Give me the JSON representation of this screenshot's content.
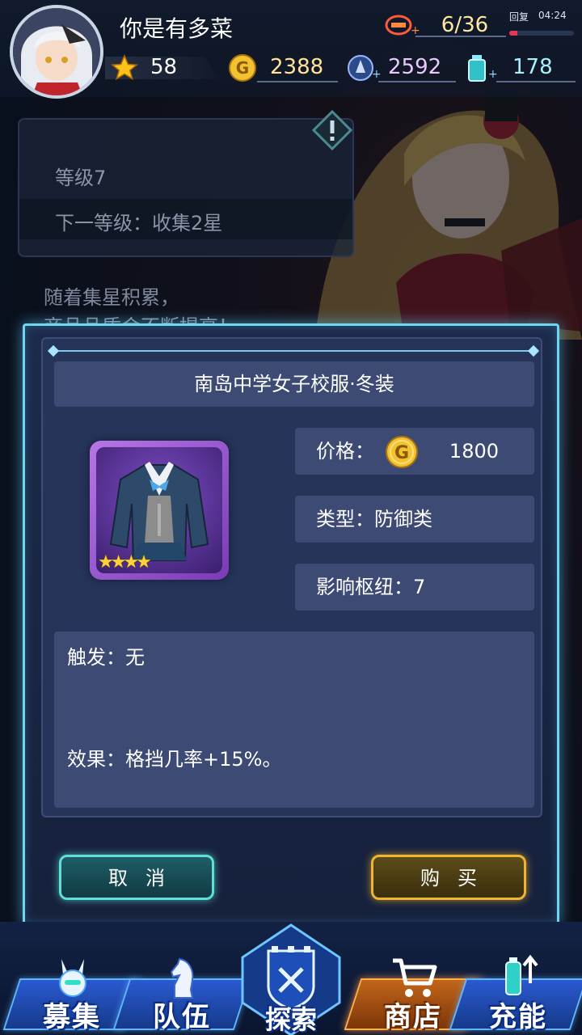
{
  "player": {
    "name": "你是有多菜",
    "stars": "58",
    "gold": "2388",
    "crystal": "2592",
    "energy": "178"
  },
  "stamina": {
    "value": "6/36",
    "recover_label": "回复",
    "recover_time": "04:24",
    "recover_progress": 0.12
  },
  "background_panel": {
    "level": "等级7",
    "next_level": "下一等级：收集2星",
    "description_line1": "随着集星积累，",
    "description_line2": "商品品质会不断提高！"
  },
  "dialog": {
    "item_name": "南岛中学女子校服·冬装",
    "item_star_count": 4,
    "item_stars": "★★★★",
    "price_label": "价格：",
    "price_value": "1800",
    "type_text": "类型：防御类",
    "hub_text": "影响枢纽：7",
    "trigger_text": "触发：无",
    "effect_text": "效果：格挡几率+15%。",
    "cancel_label": "取消",
    "buy_label": "购买"
  },
  "nav": {
    "recruit": "募集",
    "team": "队伍",
    "explore": "探索",
    "shop": "商店",
    "charge": "充能"
  },
  "colors": {
    "dialog_border": "#6fd6f2",
    "cancel_accent": "#5fe0d6",
    "buy_accent": "#f0b430",
    "gold_text": "#ffe39a",
    "crystal_text": "#e8c8ff",
    "energy_text": "#a8f0ff"
  }
}
